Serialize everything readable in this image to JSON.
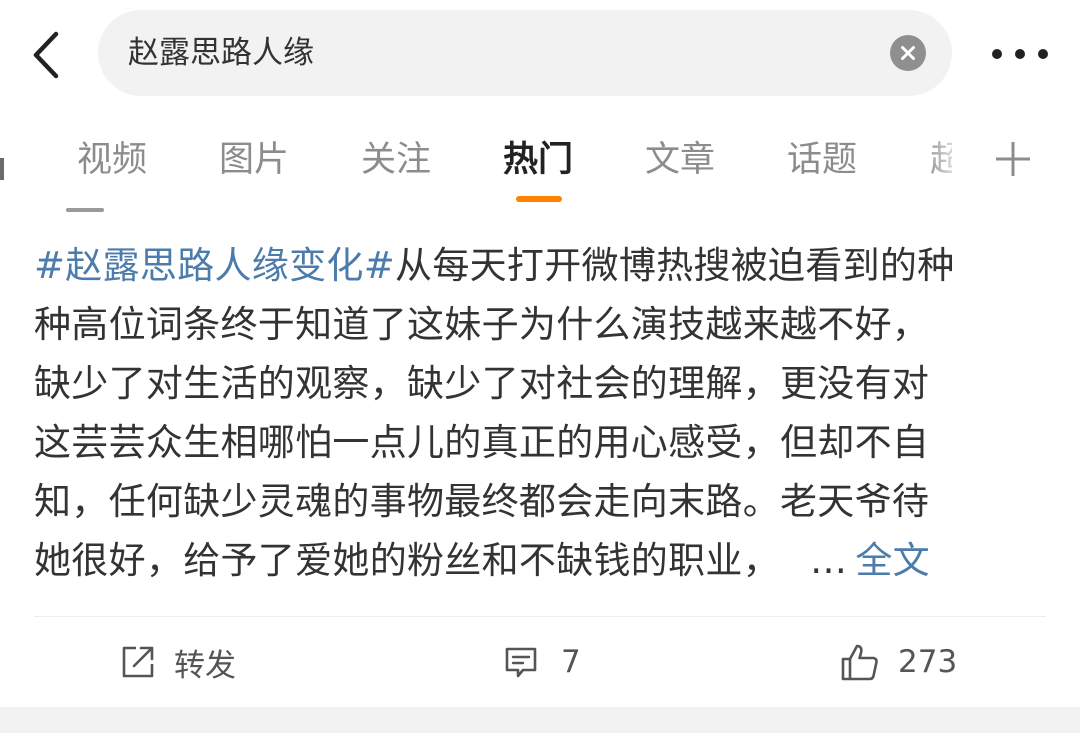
{
  "header": {
    "search_query": "赵露思路人缘",
    "icons": {
      "back": "chevron-left-icon",
      "clear": "clear-circle-icon",
      "more": "more-dots-icon"
    }
  },
  "tabs": {
    "items": [
      {
        "label": "视频",
        "active": false
      },
      {
        "label": "图片",
        "active": false
      },
      {
        "label": "关注",
        "active": false
      },
      {
        "label": "热门",
        "active": true
      },
      {
        "label": "文章",
        "active": false
      },
      {
        "label": "话题",
        "active": false
      }
    ],
    "partial_label": "超",
    "add_icon": "plus-icon"
  },
  "post": {
    "hashtag": "#赵露思路人缘变化#",
    "lines": [
      "从每天打开微博热搜被迫看到的种",
      "种高位词条终于知道了这妹子为什么演技越来越不好，",
      "缺少了对生活的观察，缺少了对社会的理解，更没有对",
      "这芸芸众生相哪怕一点儿的真正的用心感受，但却不自",
      "知，任何缺少灵魂的事物最终都会走向末路。老天爷待",
      "她很好，给予了爱她的粉丝和不缺钱的职业，"
    ],
    "ellipsis": "…",
    "full_text_link": "全文"
  },
  "actions": {
    "repost": {
      "label": "转发",
      "icon": "repost-icon"
    },
    "comment": {
      "count": "7",
      "icon": "comment-icon"
    },
    "like": {
      "count": "273",
      "icon": "thumbs-up-icon"
    }
  },
  "colors": {
    "link": "#4c7cab",
    "accent": "#ff8200",
    "search_bg": "#f2f2f2",
    "text": "#333333",
    "muted": "#8c8c8c"
  }
}
